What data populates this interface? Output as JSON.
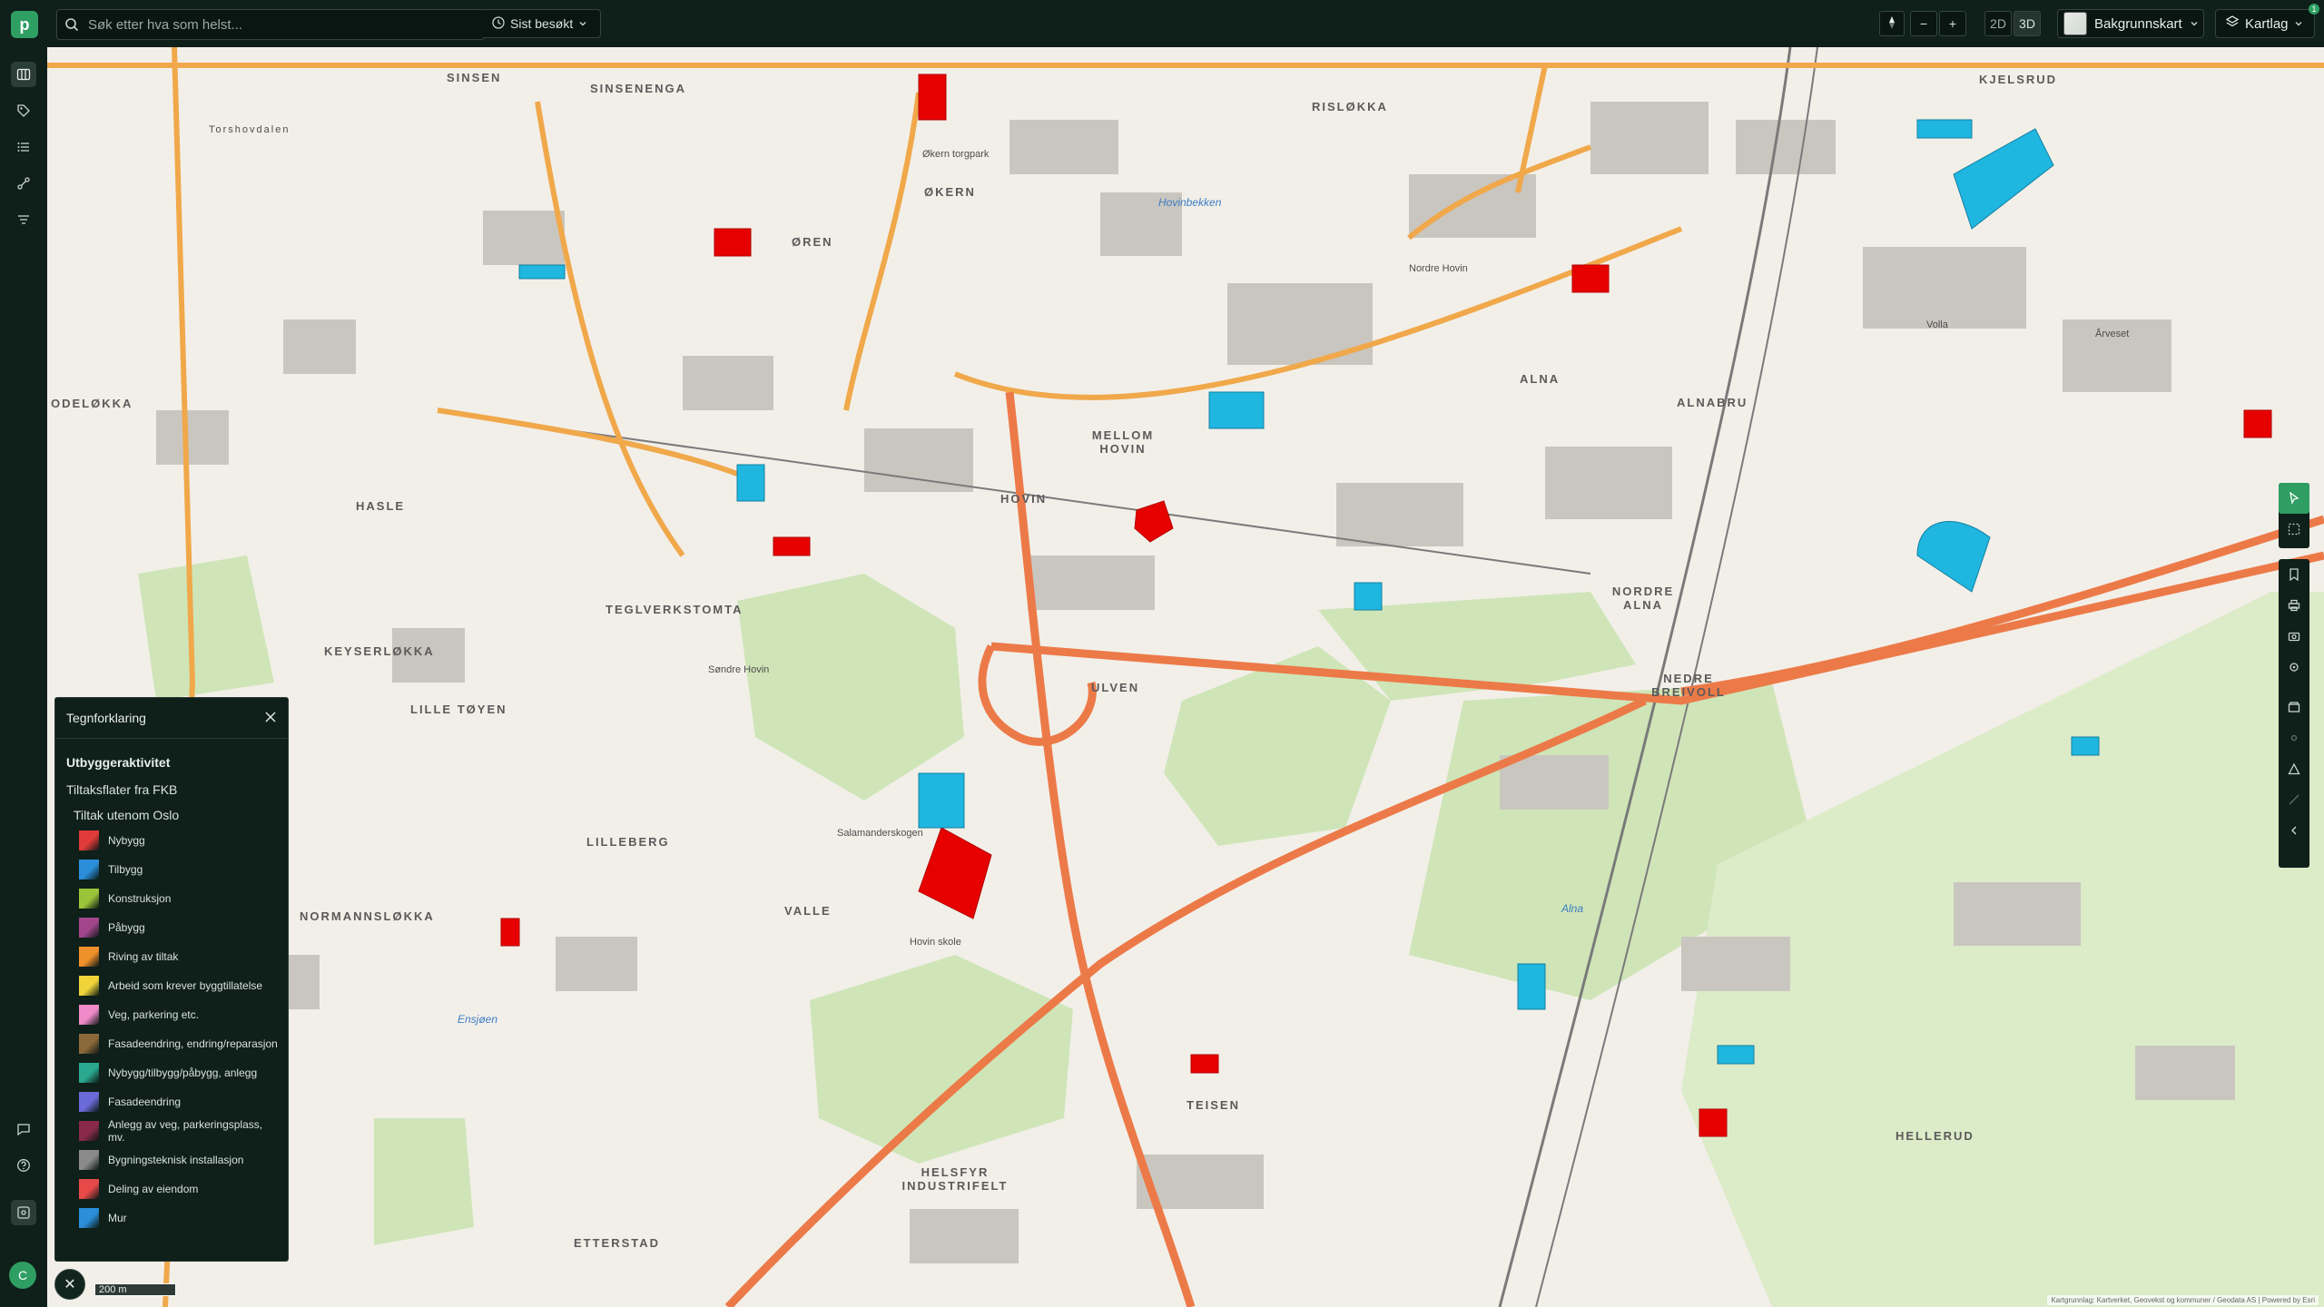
{
  "app": {
    "logo_letter": "p"
  },
  "search": {
    "placeholder": "Søk etter hva som helst...",
    "recent_label": "Sist besøkt"
  },
  "toolbar": {
    "mode_2d": "2D",
    "mode_3d": "3D",
    "zoom_out": "−",
    "zoom_in": "+",
    "basemap_label": "Bakgrunnskart",
    "layers_label": "Kartlag",
    "layers_badge": "1"
  },
  "user": {
    "initial": "C"
  },
  "legend": {
    "title": "Tegnforklaring",
    "section": "Utbyggeraktivitet",
    "group": "Tiltaksflater fra FKB",
    "subgroup": "Tiltak utenom Oslo",
    "items": [
      {
        "label": "Nybygg",
        "color": "#e03a3a"
      },
      {
        "label": "Tilbygg",
        "color": "#2a8ed8"
      },
      {
        "label": "Konstruksjon",
        "color": "#9bc43a"
      },
      {
        "label": "Påbygg",
        "color": "#a2468c"
      },
      {
        "label": "Riving av tiltak",
        "color": "#f0902a"
      },
      {
        "label": "Arbeid som krever byggtillatelse",
        "color": "#f0d43a"
      },
      {
        "label": "Veg, parkering etc.",
        "color": "#f08ac8"
      },
      {
        "label": "Fasadeendring, endring/reparasjon",
        "color": "#8b6a3a"
      },
      {
        "label": "Nybygg/tilbygg/påbygg, anlegg",
        "color": "#2aa890"
      },
      {
        "label": "Fasadeendring",
        "color": "#6a6ad8"
      },
      {
        "label": "Anlegg av veg, parkeringsplass, mv.",
        "color": "#8a2a4a"
      },
      {
        "label": "Bygningsteknisk installasjon",
        "color": "#8a8a8a"
      },
      {
        "label": "Deling av eiendom",
        "color": "#e84a4a"
      },
      {
        "label": "Mur",
        "color": "#2a8ed8"
      }
    ]
  },
  "scale": {
    "label": "200 m"
  },
  "attribution": "Kartgrunnlag: Kartverket, Geovekst og kommuner / Geodata AS | Powered by Esri",
  "map": {
    "places": [
      {
        "text": "SINSEN"
      },
      {
        "text": "SINSENENGA"
      },
      {
        "text": "RISLØKKA"
      },
      {
        "text": "KJELSRUD"
      },
      {
        "text": "ØKERN"
      },
      {
        "text": "ØREN"
      },
      {
        "text": "Torshovdalen"
      },
      {
        "text": "ODELØKKA"
      },
      {
        "text": "ALNA"
      },
      {
        "text": "ALNABRU"
      },
      {
        "text": "MELLOM HOVIN"
      },
      {
        "text": "HOVIN"
      },
      {
        "text": "HASLE"
      },
      {
        "text": "TEGLVERKSTOMTA"
      },
      {
        "text": "KEYSERLØKKA"
      },
      {
        "text": "LILLE TØYEN"
      },
      {
        "text": "ULVEN"
      },
      {
        "text": "NORDRE ALNA"
      },
      {
        "text": "NEDRE BREIVOLL"
      },
      {
        "text": "LILLEBERG"
      },
      {
        "text": "VALLE"
      },
      {
        "text": "NORMANNSLØKKA"
      },
      {
        "text": "TEISEN"
      },
      {
        "text": "HELLERUD"
      },
      {
        "text": "HELSFYR INDUSTRIFELT"
      },
      {
        "text": "ETTERSTAD"
      },
      {
        "text": "Nordre Hovin"
      },
      {
        "text": "Økern torgpark"
      },
      {
        "text": "Søndre Hovin"
      },
      {
        "text": "Salamanderskogen"
      },
      {
        "text": "Hovin skole"
      },
      {
        "text": "Volla"
      },
      {
        "text": "Årveset"
      }
    ],
    "water": [
      {
        "text": "Alna"
      },
      {
        "text": "Hovinbekken"
      },
      {
        "text": "Ensjøen"
      }
    ]
  }
}
